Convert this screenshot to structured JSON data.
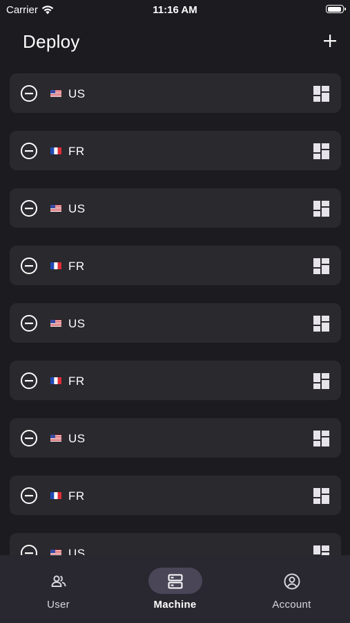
{
  "status_bar": {
    "carrier": "Carrier",
    "time": "11:16 AM"
  },
  "header": {
    "title": "Deploy"
  },
  "machines": [
    {
      "flag": "us-flag-icon",
      "code": "US"
    },
    {
      "flag": "fr-flag-icon",
      "code": "FR"
    },
    {
      "flag": "us-flag-icon",
      "code": "US"
    },
    {
      "flag": "fr-flag-icon",
      "code": "FR"
    },
    {
      "flag": "us-flag-icon",
      "code": "US"
    },
    {
      "flag": "fr-flag-icon",
      "code": "FR"
    },
    {
      "flag": "us-flag-icon",
      "code": "US"
    },
    {
      "flag": "fr-flag-icon",
      "code": "FR"
    },
    {
      "flag": "us-flag-icon",
      "code": "US"
    }
  ],
  "tabs": [
    {
      "label": "User",
      "icon": "users-icon"
    },
    {
      "label": "Machine",
      "icon": "server-icon",
      "active": true
    },
    {
      "label": "Account",
      "icon": "account-circle-icon"
    }
  ],
  "colors": {
    "background": "#1c1b1f",
    "card": "#2a292e",
    "tabbar": "#29272f",
    "active_pill": "#4a4658"
  }
}
